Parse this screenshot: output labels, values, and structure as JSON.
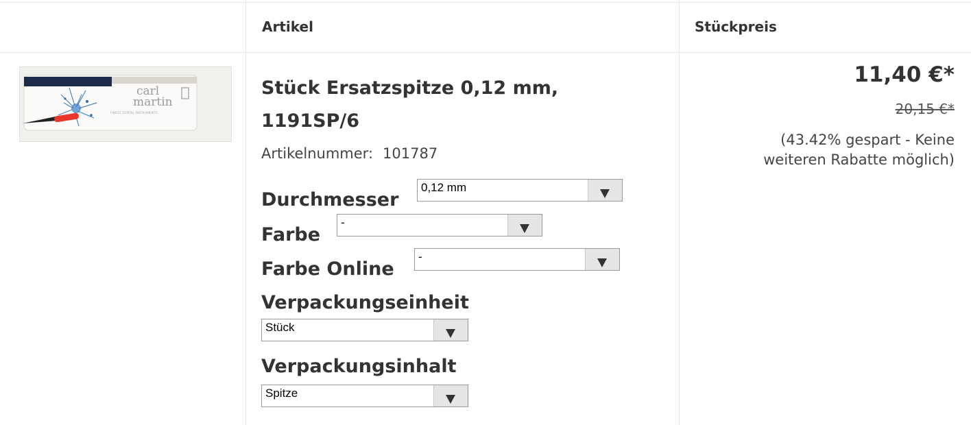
{
  "header": {
    "col_image": "",
    "col_article": "Artikel",
    "col_price": "Stückpreis"
  },
  "product": {
    "title_line1": "Stück Ersatzspitze 0,12 mm,",
    "title_line2": "1191SP/6",
    "article_number_label": "Artikelnummer:",
    "article_number": "101787",
    "image_brand_line1": "carl",
    "image_brand_line2": "martin",
    "image_brand_tagline": "FINEST DENTAL INSTRUMENTS"
  },
  "options": {
    "durchmesser": {
      "label": "Durchmesser",
      "value": "0,12 mm"
    },
    "farbe": {
      "label": "Farbe",
      "value": "-"
    },
    "farbe_online": {
      "label": "Farbe Online",
      "value": "-"
    },
    "verpackungseinheit": {
      "label": "Verpackungseinheit",
      "value": "Stück"
    },
    "verpackungsinhalt": {
      "label": "Verpackungsinhalt",
      "value": "Spitze"
    }
  },
  "pricing": {
    "price": "11,40 €*",
    "old_price": "20,15 €*",
    "savings_note": "(43.42% gespart - Keine weiteren Rabatte möglich)"
  },
  "colors": {
    "border": "#e6e6e6",
    "text": "#333333",
    "select_arrow_bg": "#e5e5e5"
  }
}
